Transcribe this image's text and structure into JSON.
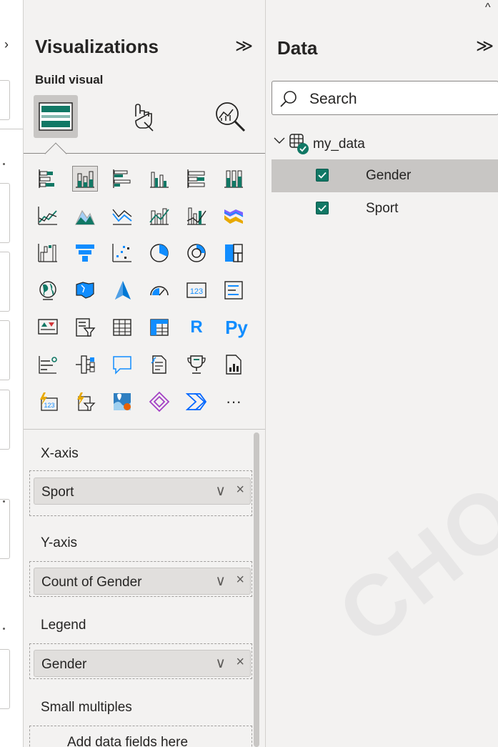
{
  "visualizations_pane": {
    "title": "Visualizations",
    "collapse_glyph": "≫",
    "build_visual_label": "Build visual",
    "mode_tabs": [
      {
        "name": "build-visual-tab",
        "icon": "build-visual-icon",
        "selected": true
      },
      {
        "name": "format-visual-tab",
        "icon": "format-paintbrush-icon",
        "selected": false
      },
      {
        "name": "analytics-tab",
        "icon": "analytics-magnifier-icon",
        "selected": false
      }
    ],
    "gallery": [
      [
        "stacked-bar-chart-icon",
        "stacked-column-chart-icon",
        "clustered-bar-chart-icon",
        "clustered-column-chart-icon",
        "100-stacked-bar-chart-icon",
        "100-stacked-column-chart-icon"
      ],
      [
        "line-chart-icon",
        "area-chart-icon",
        "stacked-area-chart-icon",
        "line-and-stacked-column-chart-icon",
        "line-and-clustered-column-chart-icon",
        "ribbon-chart-icon"
      ],
      [
        "waterfall-chart-icon",
        "funnel-icon",
        "scatter-chart-icon",
        "pie-chart-icon",
        "donut-chart-icon",
        "treemap-icon"
      ],
      [
        "map-icon",
        "filled-map-icon",
        "azure-map-icon",
        "gauge-icon",
        "card-icon",
        "multi-row-card-icon"
      ],
      [
        "kpi-icon",
        "slicer-icon",
        "table-icon",
        "matrix-icon",
        "r-script-visual-icon",
        "python-visual-icon"
      ],
      [
        "key-influencers-icon",
        "decomposition-tree-icon",
        "qa-icon",
        "smart-narrative-icon",
        "metrics-icon",
        "paginated-report-icon"
      ],
      [
        "power-automate-card-icon",
        "power-automate-slicer-icon",
        "arcgis-map-icon",
        "power-apps-icon",
        "power-automate-icon",
        "more-visuals-icon"
      ]
    ],
    "active_visual": "clustered-column-chart-icon",
    "r_label": "R",
    "py_label": "Py",
    "card_label": "123",
    "more_label": "···",
    "wells": {
      "x_axis": {
        "label": "X-axis",
        "field": "Sport"
      },
      "y_axis": {
        "label": "Y-axis",
        "field": "Count of Gender"
      },
      "legend": {
        "label": "Legend",
        "field": "Gender"
      },
      "small_multiples": {
        "label": "Small multiples",
        "placeholder": "Add data fields here"
      }
    },
    "pill_chevron": "∨",
    "pill_remove": "×"
  },
  "data_pane": {
    "title": "Data",
    "collapse_glyph": "≫",
    "search_placeholder": "Search",
    "table_name": "my_data",
    "fields": [
      {
        "name": "Gender",
        "checked": true,
        "highlighted": true
      },
      {
        "name": "Sport",
        "checked": true,
        "highlighted": false
      }
    ]
  },
  "left_strip": {
    "expand_glyph": "›"
  },
  "top_right_glyph": "^",
  "watermark": "CHO",
  "colors": {
    "pane_bg": "#f3f2f1",
    "accent_green": "#117865",
    "accent_blue": "#118dff",
    "selected_gray": "#c8c6c4"
  }
}
